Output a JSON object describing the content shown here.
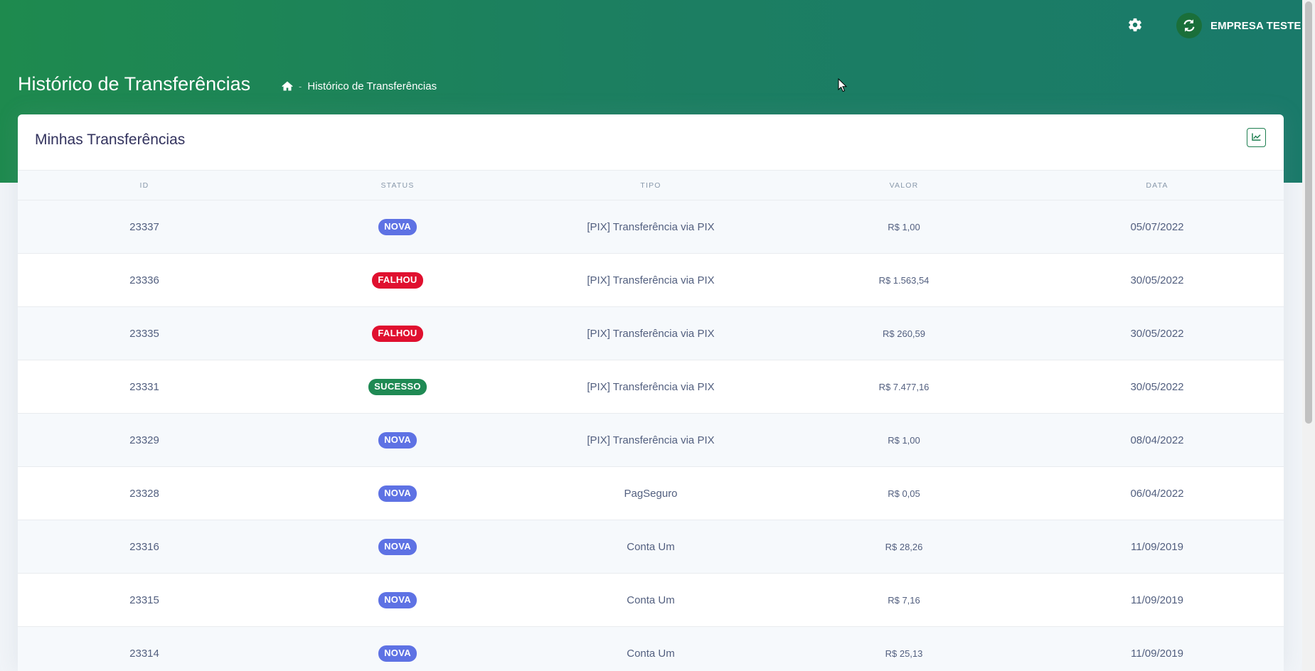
{
  "header": {
    "settings_icon": "gear-icon",
    "user": {
      "name": "EMPRESA TESTE",
      "icon": "refresh-logo-icon"
    },
    "page_title": "Histórico de Transferências",
    "breadcrumb": {
      "home_icon": "home-icon",
      "separator": "-",
      "current": "Histórico de Transferências"
    }
  },
  "card": {
    "title": "Minhas Transferências",
    "chart_button_icon": "chart-line-icon"
  },
  "table": {
    "columns": [
      "ID",
      "STATUS",
      "TIPO",
      "VALOR",
      "DATA"
    ],
    "rows": [
      {
        "id": "23337",
        "status": "NOVA",
        "tipo": "[PIX] Transferência via PIX",
        "valor": "R$ 1,00",
        "data": "05/07/2022"
      },
      {
        "id": "23336",
        "status": "FALHOU",
        "tipo": "[PIX] Transferência via PIX",
        "valor": "R$ 1.563,54",
        "data": "30/05/2022"
      },
      {
        "id": "23335",
        "status": "FALHOU",
        "tipo": "[PIX] Transferência via PIX",
        "valor": "R$ 260,59",
        "data": "30/05/2022"
      },
      {
        "id": "23331",
        "status": "SUCESSO",
        "tipo": "[PIX] Transferência via PIX",
        "valor": "R$ 7.477,16",
        "data": "30/05/2022"
      },
      {
        "id": "23329",
        "status": "NOVA",
        "tipo": "[PIX] Transferência via PIX",
        "valor": "R$ 1,00",
        "data": "08/04/2022"
      },
      {
        "id": "23328",
        "status": "NOVA",
        "tipo": "PagSeguro",
        "valor": "R$ 0,05",
        "data": "06/04/2022"
      },
      {
        "id": "23316",
        "status": "NOVA",
        "tipo": "Conta Um",
        "valor": "R$ 28,26",
        "data": "11/09/2019"
      },
      {
        "id": "23315",
        "status": "NOVA",
        "tipo": "Conta Um",
        "valor": "R$ 7,16",
        "data": "11/09/2019"
      },
      {
        "id": "23314",
        "status": "NOVA",
        "tipo": "Conta Um",
        "valor": "R$ 25,13",
        "data": "11/09/2019"
      }
    ]
  },
  "status_colors": {
    "NOVA": "#5e72e4",
    "FALHOU": "#e0102f",
    "SUCESSO": "#1f8a54"
  },
  "theme": {
    "header_gradient_start": "#1e8a4e",
    "header_gradient_end": "#1a7a6a",
    "page_background": "#f1f4f8"
  }
}
